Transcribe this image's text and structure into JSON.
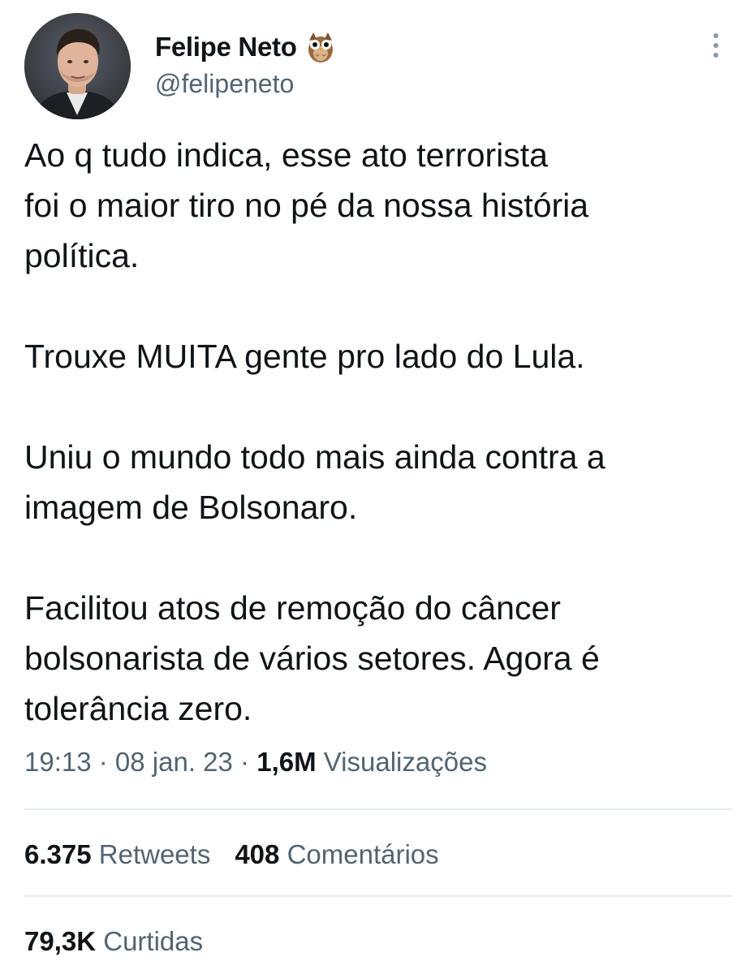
{
  "author": {
    "display_name": "Felipe Neto",
    "badge_icon": "owl-emoji-icon",
    "handle": "@felipeneto"
  },
  "tweet": {
    "paragraphs": [
      "Ao q tudo indica, esse ato terrorista\nfoi o maior tiro no pé da nossa história\npolítica.",
      "Trouxe MUITA gente pro lado do Lula.",
      "Uniu o mundo todo mais ainda contra a\nimagem de Bolsonaro.",
      "Facilitou atos de remoção do câncer\nbolsonarista de vários setores. Agora é\ntolerância zero."
    ]
  },
  "meta": {
    "time": "19:13",
    "sep1": " · ",
    "date": "08 jan. 23",
    "sep2": " · ",
    "views_count": "1,6M",
    "views_label": "Visualizações"
  },
  "stats": {
    "retweets_count": "6.375",
    "retweets_label": "Retweets",
    "comments_count": "408",
    "comments_label": "Comentários",
    "likes_count": "79,3K",
    "likes_label": "Curtidas"
  },
  "icons": {
    "more": "more-options-vertical-icon"
  },
  "colors": {
    "text_primary": "#0f1419",
    "text_secondary": "#536471",
    "divider": "#e6ecf0",
    "background": "#ffffff"
  }
}
